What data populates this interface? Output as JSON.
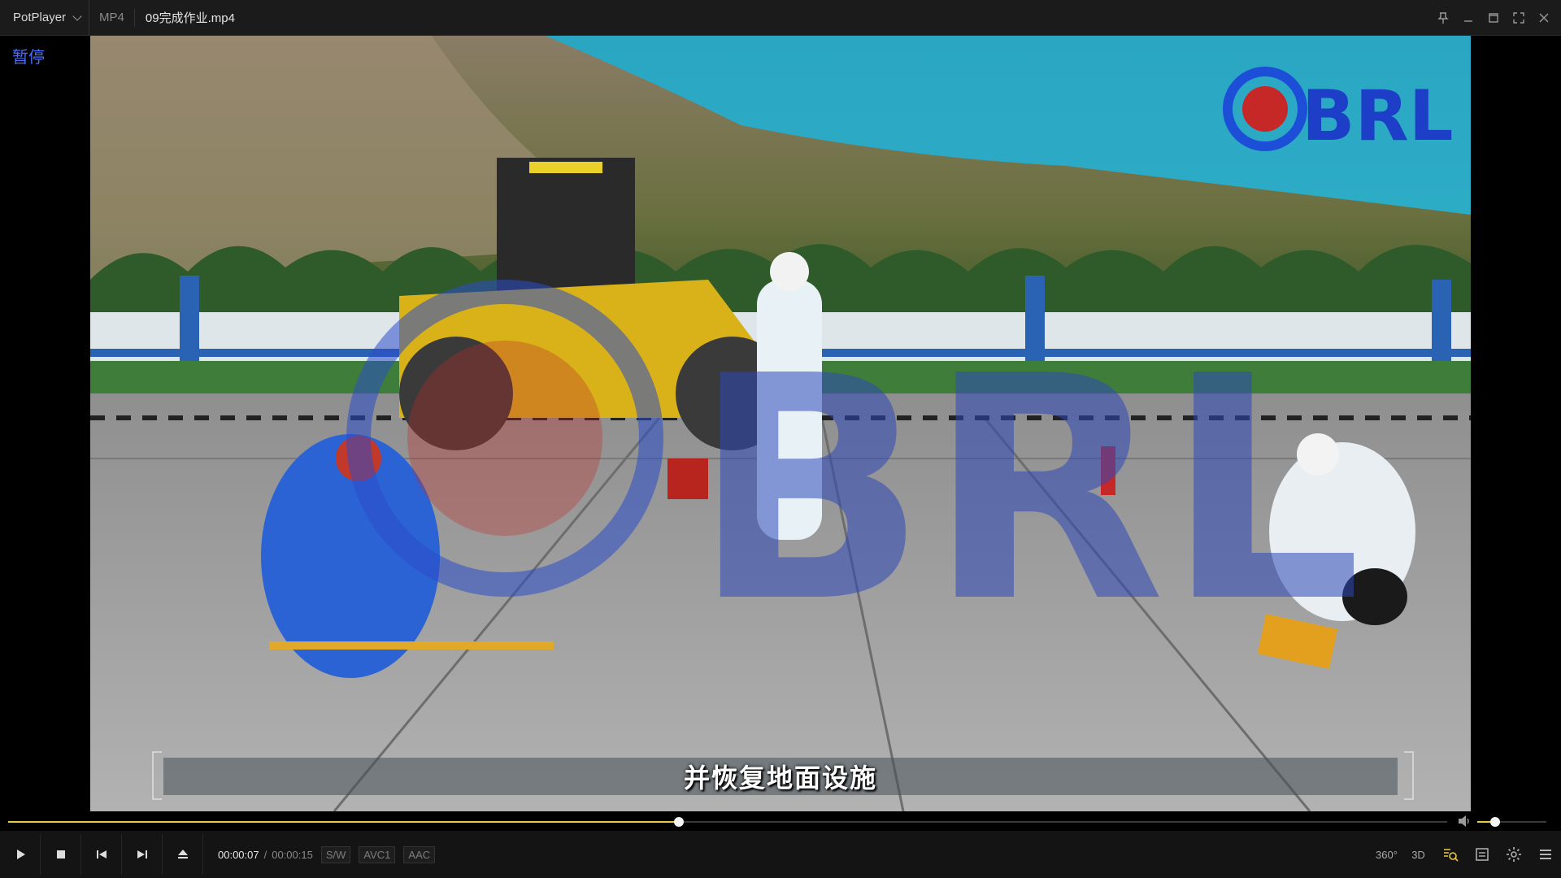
{
  "titlebar": {
    "app_name": "PotPlayer",
    "format": "MP4",
    "file_name": "09完成作业.mp4",
    "controls": [
      "pin-icon",
      "minimize-icon",
      "maximize-icon",
      "fullscreen-icon",
      "close-icon"
    ]
  },
  "video": {
    "osd_status": "暂停",
    "subtitle": "并恢复地面设施",
    "watermark": "BRL"
  },
  "playback": {
    "current_time": "00:00:07",
    "separator": "/",
    "duration": "00:00:15",
    "progress": 0.466,
    "volume": 0.26,
    "decoder_tag": "S/W",
    "video_codec": "AVC1",
    "audio_codec": "AAC"
  },
  "controls": {
    "left_buttons": [
      "play-icon",
      "stop-icon",
      "previous-icon",
      "next-icon",
      "eject-icon"
    ],
    "right_buttons": [
      {
        "name": "vr-360-button",
        "label": "360°"
      },
      {
        "name": "3d-button",
        "label": "3D"
      },
      {
        "name": "playlist-search-button",
        "label": ""
      },
      {
        "name": "chapter-button",
        "label": ""
      },
      {
        "name": "settings-button",
        "label": ""
      },
      {
        "name": "menu-button",
        "label": ""
      }
    ]
  },
  "colors": {
    "accent": "#e9c84a",
    "osd": "#4a6cff",
    "titlebar_bg": "#1b1b1b",
    "controlbar_bg": "#141414"
  }
}
